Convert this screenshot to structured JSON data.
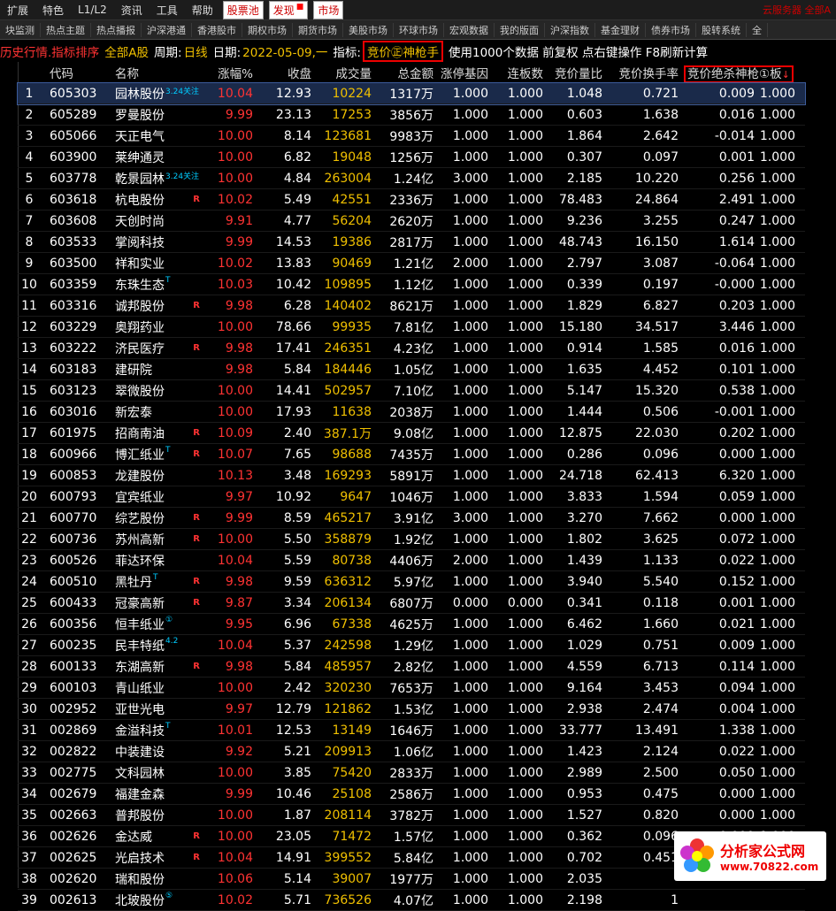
{
  "menu": {
    "items": [
      "扩展",
      "特色",
      "L1/L2",
      "资讯",
      "工具",
      "帮助"
    ],
    "boxed": [
      "股票池",
      "发现",
      "市场"
    ],
    "right": "云服务器 全部A"
  },
  "tabs": [
    "块监测",
    "热点主题",
    "热点播报",
    "沪深港通",
    "香港股市",
    "期权市场",
    "期货市场",
    "美股市场",
    "环球市场",
    "宏观数据",
    "我的版面",
    "沪深指数",
    "基金理财",
    "债券市场",
    "股转系统",
    "全"
  ],
  "info": {
    "title": "历史行情.指标排序",
    "market": "全部A股",
    "period_label": "周期:",
    "period_value": "日线",
    "date_label": "日期:",
    "date_value": "2022-05-09,一",
    "indicator_label": "指标:",
    "indicator_value": "竞价㊣神枪手",
    "tail": "使用1000个数据 前复权 点右键操作 F8刷新计算"
  },
  "columns": [
    "",
    "代码",
    "名称",
    "涨幅%",
    "收盘",
    "成交量",
    "总金额",
    "涨停基因",
    "连板数",
    "竞价量比",
    "竞价换手率",
    "竞价绝杀神枪①板",
    ""
  ],
  "sort_arrow": "↓",
  "rows": [
    {
      "n": "1",
      "code": "605303",
      "name": "园林股份",
      "tag": "3.24关注",
      "r": "",
      "chg": "10.04",
      "close": "12.93",
      "vol": "10224",
      "amt": "1317万",
      "a": "1.000",
      "b": "1.000",
      "c": "1.048",
      "d": "0.721",
      "e": "0.009",
      "f": "1.000"
    },
    {
      "n": "2",
      "code": "605289",
      "name": "罗曼股份",
      "tag": "",
      "r": "",
      "chg": "9.99",
      "close": "23.13",
      "vol": "17253",
      "amt": "3856万",
      "a": "1.000",
      "b": "1.000",
      "c": "0.603",
      "d": "1.638",
      "e": "0.016",
      "f": "1.000"
    },
    {
      "n": "3",
      "code": "605066",
      "name": "天正电气",
      "tag": "",
      "r": "",
      "chg": "10.00",
      "close": "8.14",
      "vol": "123681",
      "amt": "9983万",
      "a": "1.000",
      "b": "1.000",
      "c": "1.864",
      "d": "2.642",
      "e": "-0.014",
      "f": "1.000"
    },
    {
      "n": "4",
      "code": "603900",
      "name": "莱绅通灵",
      "tag": "",
      "r": "",
      "chg": "10.00",
      "close": "6.82",
      "vol": "19048",
      "amt": "1256万",
      "a": "1.000",
      "b": "1.000",
      "c": "0.307",
      "d": "0.097",
      "e": "0.001",
      "f": "1.000"
    },
    {
      "n": "5",
      "code": "603778",
      "name": "乾景园林",
      "tag": "3.24关注",
      "r": "",
      "chg": "10.00",
      "close": "4.84",
      "vol": "263004",
      "amt": "1.24亿",
      "a": "3.000",
      "b": "1.000",
      "c": "2.185",
      "d": "10.220",
      "e": "0.256",
      "f": "1.000"
    },
    {
      "n": "6",
      "code": "603618",
      "name": "杭电股份",
      "tag": "",
      "r": "R",
      "chg": "10.02",
      "close": "5.49",
      "vol": "42551",
      "amt": "2336万",
      "a": "1.000",
      "b": "1.000",
      "c": "78.483",
      "d": "24.864",
      "e": "2.491",
      "f": "1.000"
    },
    {
      "n": "7",
      "code": "603608",
      "name": "天创时尚",
      "tag": "",
      "r": "",
      "chg": "9.91",
      "close": "4.77",
      "vol": "56204",
      "amt": "2620万",
      "a": "1.000",
      "b": "1.000",
      "c": "9.236",
      "d": "3.255",
      "e": "0.247",
      "f": "1.000"
    },
    {
      "n": "8",
      "code": "603533",
      "name": "掌阅科技",
      "tag": "",
      "r": "",
      "chg": "9.99",
      "close": "14.53",
      "vol": "19386",
      "amt": "2817万",
      "a": "1.000",
      "b": "1.000",
      "c": "48.743",
      "d": "16.150",
      "e": "1.614",
      "f": "1.000"
    },
    {
      "n": "9",
      "code": "603500",
      "name": "祥和实业",
      "tag": "",
      "r": "",
      "chg": "10.02",
      "close": "13.83",
      "vol": "90469",
      "amt": "1.21亿",
      "a": "2.000",
      "b": "1.000",
      "c": "2.797",
      "d": "3.087",
      "e": "-0.064",
      "f": "1.000"
    },
    {
      "n": "10",
      "code": "603359",
      "name": "东珠生态",
      "tag": "T",
      "r": "",
      "chg": "10.03",
      "close": "10.42",
      "vol": "109895",
      "amt": "1.12亿",
      "a": "1.000",
      "b": "1.000",
      "c": "0.339",
      "d": "0.197",
      "e": "-0.000",
      "f": "1.000"
    },
    {
      "n": "11",
      "code": "603316",
      "name": "诚邦股份",
      "tag": "",
      "r": "R",
      "chg": "9.98",
      "close": "6.28",
      "vol": "140402",
      "amt": "8621万",
      "a": "1.000",
      "b": "1.000",
      "c": "1.829",
      "d": "6.827",
      "e": "0.203",
      "f": "1.000"
    },
    {
      "n": "12",
      "code": "603229",
      "name": "奥翔药业",
      "tag": "",
      "r": "",
      "chg": "10.00",
      "close": "78.66",
      "vol": "99935",
      "amt": "7.81亿",
      "a": "1.000",
      "b": "1.000",
      "c": "15.180",
      "d": "34.517",
      "e": "3.446",
      "f": "1.000"
    },
    {
      "n": "13",
      "code": "603222",
      "name": "济民医疗",
      "tag": "",
      "r": "R",
      "chg": "9.98",
      "close": "17.41",
      "vol": "246351",
      "amt": "4.23亿",
      "a": "1.000",
      "b": "1.000",
      "c": "0.914",
      "d": "1.585",
      "e": "0.016",
      "f": "1.000"
    },
    {
      "n": "14",
      "code": "603183",
      "name": "建研院",
      "tag": "",
      "r": "",
      "chg": "9.98",
      "close": "5.84",
      "vol": "184446",
      "amt": "1.05亿",
      "a": "1.000",
      "b": "1.000",
      "c": "1.635",
      "d": "4.452",
      "e": "0.101",
      "f": "1.000"
    },
    {
      "n": "15",
      "code": "603123",
      "name": "翠微股份",
      "tag": "",
      "r": "",
      "chg": "10.00",
      "close": "14.41",
      "vol": "502957",
      "amt": "7.10亿",
      "a": "1.000",
      "b": "1.000",
      "c": "5.147",
      "d": "15.320",
      "e": "0.538",
      "f": "1.000"
    },
    {
      "n": "16",
      "code": "603016",
      "name": "新宏泰",
      "tag": "",
      "r": "",
      "chg": "10.00",
      "close": "17.93",
      "vol": "11638",
      "amt": "2038万",
      "a": "1.000",
      "b": "1.000",
      "c": "1.444",
      "d": "0.506",
      "e": "-0.001",
      "f": "1.000"
    },
    {
      "n": "17",
      "code": "601975",
      "name": "招商南油",
      "tag": "",
      "r": "R",
      "chg": "10.09",
      "close": "2.40",
      "vol": "387.1万",
      "amt": "9.08亿",
      "a": "1.000",
      "b": "1.000",
      "c": "12.875",
      "d": "22.030",
      "e": "0.202",
      "f": "1.000"
    },
    {
      "n": "18",
      "code": "600966",
      "name": "博汇纸业",
      "tag": "T",
      "r": "R",
      "chg": "10.07",
      "close": "7.65",
      "vol": "98688",
      "amt": "7435万",
      "a": "1.000",
      "b": "1.000",
      "c": "0.286",
      "d": "0.096",
      "e": "0.000",
      "f": "1.000"
    },
    {
      "n": "19",
      "code": "600853",
      "name": "龙建股份",
      "tag": "",
      "r": "",
      "chg": "10.13",
      "close": "3.48",
      "vol": "169293",
      "amt": "5891万",
      "a": "1.000",
      "b": "1.000",
      "c": "24.718",
      "d": "62.413",
      "e": "6.320",
      "f": "1.000"
    },
    {
      "n": "20",
      "code": "600793",
      "name": "宜宾纸业",
      "tag": "",
      "r": "",
      "chg": "9.97",
      "close": "10.92",
      "vol": "9647",
      "amt": "1046万",
      "a": "1.000",
      "b": "1.000",
      "c": "3.833",
      "d": "1.594",
      "e": "0.059",
      "f": "1.000"
    },
    {
      "n": "21",
      "code": "600770",
      "name": "综艺股份",
      "tag": "",
      "r": "R",
      "chg": "9.99",
      "close": "8.59",
      "vol": "465217",
      "amt": "3.91亿",
      "a": "3.000",
      "b": "1.000",
      "c": "3.270",
      "d": "7.662",
      "e": "0.000",
      "f": "1.000"
    },
    {
      "n": "22",
      "code": "600736",
      "name": "苏州高新",
      "tag": "",
      "r": "R",
      "chg": "10.00",
      "close": "5.50",
      "vol": "358879",
      "amt": "1.92亿",
      "a": "1.000",
      "b": "1.000",
      "c": "1.802",
      "d": "3.625",
      "e": "0.072",
      "f": "1.000"
    },
    {
      "n": "23",
      "code": "600526",
      "name": "菲达环保",
      "tag": "",
      "r": "",
      "chg": "10.04",
      "close": "5.59",
      "vol": "80738",
      "amt": "4406万",
      "a": "2.000",
      "b": "1.000",
      "c": "1.439",
      "d": "1.133",
      "e": "0.022",
      "f": "1.000"
    },
    {
      "n": "24",
      "code": "600510",
      "name": "黑牡丹",
      "tag": "T",
      "r": "R",
      "chg": "9.98",
      "close": "9.59",
      "vol": "636312",
      "amt": "5.97亿",
      "a": "1.000",
      "b": "1.000",
      "c": "3.940",
      "d": "5.540",
      "e": "0.152",
      "f": "1.000"
    },
    {
      "n": "25",
      "code": "600433",
      "name": "冠豪高新",
      "tag": "",
      "r": "R",
      "chg": "9.87",
      "close": "3.34",
      "vol": "206134",
      "amt": "6807万",
      "a": "0.000",
      "b": "0.000",
      "c": "0.341",
      "d": "0.118",
      "e": "0.001",
      "f": "1.000"
    },
    {
      "n": "26",
      "code": "600356",
      "name": "恒丰纸业",
      "tag": "①",
      "r": "",
      "chg": "9.95",
      "close": "6.96",
      "vol": "67338",
      "amt": "4625万",
      "a": "1.000",
      "b": "1.000",
      "c": "6.462",
      "d": "1.660",
      "e": "0.021",
      "f": "1.000"
    },
    {
      "n": "27",
      "code": "600235",
      "name": "民丰特纸",
      "tag": "4.2",
      "r": "",
      "chg": "10.04",
      "close": "5.37",
      "vol": "242598",
      "amt": "1.29亿",
      "a": "1.000",
      "b": "1.000",
      "c": "1.029",
      "d": "0.751",
      "e": "0.009",
      "f": "1.000"
    },
    {
      "n": "28",
      "code": "600133",
      "name": "东湖高新",
      "tag": "",
      "r": "R",
      "chg": "9.98",
      "close": "5.84",
      "vol": "485957",
      "amt": "2.82亿",
      "a": "1.000",
      "b": "1.000",
      "c": "4.559",
      "d": "6.713",
      "e": "0.114",
      "f": "1.000"
    },
    {
      "n": "29",
      "code": "600103",
      "name": "青山纸业",
      "tag": "",
      "r": "",
      "chg": "10.00",
      "close": "2.42",
      "vol": "320230",
      "amt": "7653万",
      "a": "1.000",
      "b": "1.000",
      "c": "9.164",
      "d": "3.453",
      "e": "0.094",
      "f": "1.000"
    },
    {
      "n": "30",
      "code": "002952",
      "name": "亚世光电",
      "tag": "",
      "r": "",
      "chg": "9.97",
      "close": "12.79",
      "vol": "121862",
      "amt": "1.53亿",
      "a": "1.000",
      "b": "1.000",
      "c": "2.938",
      "d": "2.474",
      "e": "0.004",
      "f": "1.000"
    },
    {
      "n": "31",
      "code": "002869",
      "name": "金溢科技",
      "tag": "T",
      "r": "",
      "chg": "10.01",
      "close": "12.53",
      "vol": "13149",
      "amt": "1646万",
      "a": "1.000",
      "b": "1.000",
      "c": "33.777",
      "d": "13.491",
      "e": "1.338",
      "f": "1.000"
    },
    {
      "n": "32",
      "code": "002822",
      "name": "中装建设",
      "tag": "",
      "r": "",
      "chg": "9.92",
      "close": "5.21",
      "vol": "209913",
      "amt": "1.06亿",
      "a": "1.000",
      "b": "1.000",
      "c": "1.423",
      "d": "2.124",
      "e": "0.022",
      "f": "1.000"
    },
    {
      "n": "33",
      "code": "002775",
      "name": "文科园林",
      "tag": "",
      "r": "",
      "chg": "10.00",
      "close": "3.85",
      "vol": "75420",
      "amt": "2833万",
      "a": "1.000",
      "b": "1.000",
      "c": "2.989",
      "d": "2.500",
      "e": "0.050",
      "f": "1.000"
    },
    {
      "n": "34",
      "code": "002679",
      "name": "福建金森",
      "tag": "",
      "r": "",
      "chg": "9.99",
      "close": "10.46",
      "vol": "25108",
      "amt": "2586万",
      "a": "1.000",
      "b": "1.000",
      "c": "0.953",
      "d": "0.475",
      "e": "0.000",
      "f": "1.000"
    },
    {
      "n": "35",
      "code": "002663",
      "name": "普邦股份",
      "tag": "",
      "r": "",
      "chg": "10.00",
      "close": "1.87",
      "vol": "208114",
      "amt": "3782万",
      "a": "1.000",
      "b": "1.000",
      "c": "1.527",
      "d": "0.820",
      "e": "0.000",
      "f": "1.000"
    },
    {
      "n": "36",
      "code": "002626",
      "name": "金达威",
      "tag": "",
      "r": "R",
      "chg": "10.00",
      "close": "23.05",
      "vol": "71472",
      "amt": "1.57亿",
      "a": "1.000",
      "b": "1.000",
      "c": "0.362",
      "d": "0.096",
      "e": "0.009",
      "f": "1.000"
    },
    {
      "n": "37",
      "code": "002625",
      "name": "光启技术",
      "tag": "",
      "r": "R",
      "chg": "10.04",
      "close": "14.91",
      "vol": "399552",
      "amt": "5.84亿",
      "a": "1.000",
      "b": "1.000",
      "c": "0.702",
      "d": "0.451",
      "e": "-0.005",
      "f": "1.000"
    },
    {
      "n": "38",
      "code": "002620",
      "name": "瑞和股份",
      "tag": "",
      "r": "",
      "chg": "10.06",
      "close": "5.14",
      "vol": "39007",
      "amt": "1977万",
      "a": "1.000",
      "b": "1.000",
      "c": "2.035",
      "d": "",
      "e": "",
      "f": ""
    },
    {
      "n": "39",
      "code": "002613",
      "name": "北玻股份",
      "tag": "⑤",
      "r": "",
      "chg": "10.02",
      "close": "5.71",
      "vol": "736526",
      "amt": "4.07亿",
      "a": "1.000",
      "b": "1.000",
      "c": "2.198",
      "d": "1",
      "e": "",
      "f": ""
    }
  ],
  "watermark": {
    "line1": "分析家公式网",
    "line2": "www.70822.com"
  },
  "colors": {
    "up": "#ff3333",
    "volume": "#f0c000",
    "background": "#000000",
    "highlight_box": "#ee0000"
  }
}
